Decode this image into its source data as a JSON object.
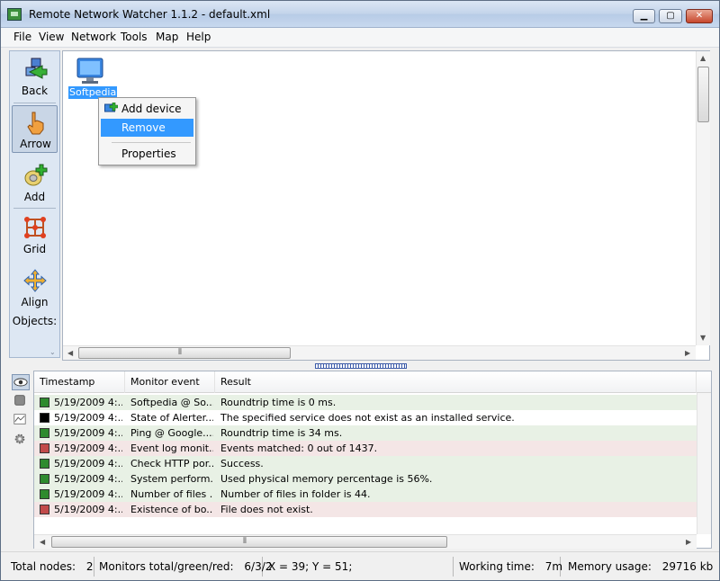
{
  "window": {
    "title": "Remote Network Watcher 1.1.2 - default.xml",
    "minimize_label": "▁",
    "maximize_label": "▢",
    "close_label": "✕"
  },
  "menu": [
    "File",
    "View",
    "Network",
    "Tools",
    "Map",
    "Help"
  ],
  "toolbar": {
    "items": [
      {
        "label": "Back",
        "icon": "back-icon"
      },
      {
        "label": "Arrow",
        "icon": "hand-pointer-icon",
        "active": true
      },
      {
        "label": "Add",
        "icon": "add-device-icon"
      },
      {
        "label": "Grid",
        "icon": "grid-icon"
      },
      {
        "label": "Align",
        "label2": "Objects:",
        "icon": "align-icon"
      }
    ]
  },
  "canvas": {
    "device": {
      "label": "Softpedia",
      "icon": "monitor-icon"
    }
  },
  "context_menu": {
    "items": [
      "Add device",
      "Remove",
      "Properties"
    ],
    "highlighted": "Remove"
  },
  "log": {
    "columns": [
      "Timestamp",
      "Monitor event",
      "Result"
    ],
    "rows": [
      {
        "status": "green",
        "timestamp": "5/19/2009 4:...",
        "event": "Softpedia @ So...",
        "result": "Roundtrip time is 0 ms."
      },
      {
        "status": "black",
        "timestamp": "5/19/2009 4:...",
        "event": "State of Alerter...",
        "result": "The specified service does not exist as an installed service."
      },
      {
        "status": "green",
        "timestamp": "5/19/2009 4:...",
        "event": "Ping @ Google....",
        "result": "Roundtrip time is 34 ms."
      },
      {
        "status": "red",
        "timestamp": "5/19/2009 4:...",
        "event": "Event log monit...",
        "result": "Events matched: 0 out of 1437."
      },
      {
        "status": "green",
        "timestamp": "5/19/2009 4:...",
        "event": "Check HTTP por...",
        "result": "Success."
      },
      {
        "status": "green",
        "timestamp": "5/19/2009 4:...",
        "event": "System perform...",
        "result": "Used physical memory percentage is 56%."
      },
      {
        "status": "green",
        "timestamp": "5/19/2009 4:...",
        "event": "Number of files ...",
        "result": "Number of files in folder is 44."
      },
      {
        "status": "red",
        "timestamp": "5/19/2009 4:...",
        "event": "Existence of bo...",
        "result": "File does not exist."
      }
    ]
  },
  "status": {
    "total_nodes_label": "Total nodes:",
    "total_nodes_value": "2",
    "monitors_label": "Monitors total/green/red:",
    "monitors_value": "6/3/2",
    "coords": "X = 39; Y = 51;",
    "working_time_label": "Working time:",
    "working_time_value": "7m",
    "memory_label": "Memory usage:",
    "memory_value": "29716 kb"
  },
  "colors": {
    "green": "#2e8b2e",
    "red": "#c24a4a",
    "black": "#000000",
    "highlight": "#3399ff"
  }
}
